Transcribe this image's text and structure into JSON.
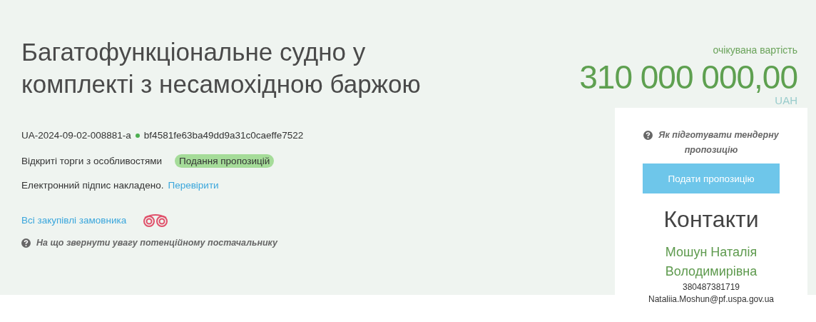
{
  "title": "Багатофункціональне судно у комплекті з несамохідною баржою",
  "tender_id": "UA-2024-09-02-008881-a",
  "hash": "bf4581fe63ba49dd9a31c0caeffe7522",
  "procedure": "Відкриті торги з особливостями",
  "status_badge": "Подання пропозицій",
  "signature": {
    "text": "Електронний підпис накладено.",
    "link": "Перевірити"
  },
  "buyer_link": "Всі закупівлі замовника",
  "hint": "На що звернути увагу потенційному постачальнику",
  "price": {
    "label": "очікувана вартість",
    "amount": "310 000 000,00",
    "currency": "UAH"
  },
  "card": {
    "hint": "Як підготувати тендерну пропозицію",
    "button": "Подати пропозицію",
    "contacts_title": "Контакти",
    "name": "Мошун Наталія Володимирівна",
    "phone": "380487381719",
    "email": "Nataliia.Moshun@pf.uspa.gov.ua"
  }
}
